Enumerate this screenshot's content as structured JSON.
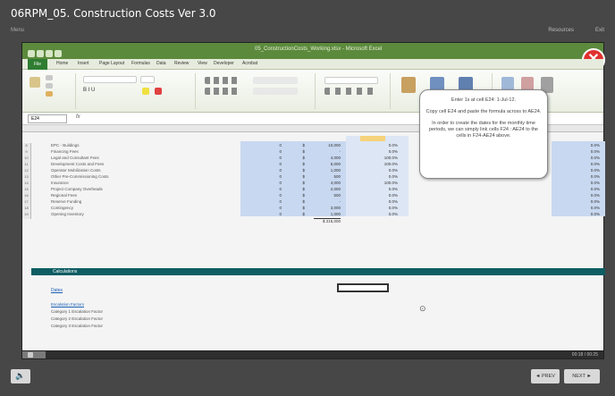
{
  "player": {
    "course_title": "06RPM_05. Construction Costs Ver 3.0",
    "menu": "Menu",
    "resources": "Resources",
    "exit": "Exit",
    "time": "00:18 / 00:25",
    "prev": "◄ PREV",
    "next": "NEXT ►",
    "volume_icon": "speaker-icon",
    "progress": 0.04
  },
  "excel": {
    "window_title": "05_ConstructionCosts_Working.xlsx - Microsoft Excel",
    "tabs": [
      "File",
      "Home",
      "Insert",
      "Page Layout",
      "Formulas",
      "Data",
      "Review",
      "View",
      "Developer",
      "Acrobat"
    ],
    "name_box": "E24",
    "rows": [
      {
        "label": "EPC - Buildings",
        "v1": "0",
        "v2": "$",
        "v3": "10,000",
        "v4": "0.0%",
        "pct": "0.0%"
      },
      {
        "label": "Financing Fees",
        "v1": "0",
        "v2": "$",
        "v3": "-",
        "v4": "0.0%",
        "pct": "0.0%"
      },
      {
        "label": "Legal and Consultant Fees",
        "v1": "0",
        "v2": "$",
        "v3": "4,000",
        "v4": "100.0%",
        "pct": "0.0%"
      },
      {
        "label": "Development Costs and Fees",
        "v1": "0",
        "v2": "$",
        "v3": "6,000",
        "v4": "100.0%",
        "pct": "0.0%"
      },
      {
        "label": "Operator Mobilization Costs",
        "v1": "0",
        "v2": "$",
        "v3": "1,000",
        "v4": "0.0%",
        "pct": "0.0%"
      },
      {
        "label": "Other Pre-Commissioning Costs",
        "v1": "0",
        "v2": "$",
        "v3": "500",
        "v4": "0.0%",
        "pct": "0.0%"
      },
      {
        "label": "Insurance",
        "v1": "0",
        "v2": "$",
        "v3": "4,000",
        "v4": "100.0%",
        "pct": "0.0%"
      },
      {
        "label": "Project Company Overheads",
        "v1": "0",
        "v2": "$",
        "v3": "2,000",
        "v4": "0.0%",
        "pct": "0.0%"
      },
      {
        "label": "Regional Fees",
        "v1": "0",
        "v2": "$",
        "v3": "500",
        "v4": "0.0%",
        "pct": "0.0%"
      },
      {
        "label": "Reserve Funding",
        "v1": "0",
        "v2": "$",
        "v3": "-",
        "v4": "0.0%",
        "pct": "0.0%"
      },
      {
        "label": "Contingency",
        "v1": "0",
        "v2": "$",
        "v3": "3,000",
        "v4": "0.0%",
        "pct": "0.0%"
      },
      {
        "label": "Opening Inventory",
        "v1": "0",
        "v2": "$",
        "v3": "1,000",
        "v4": "0.0%",
        "pct": "0.0%"
      }
    ],
    "total": "215,000",
    "section_title": "Calculations",
    "dates_label": "Dates",
    "escalation_label": "Escalation Factors",
    "cat_rows": [
      "Category 1 Escalation Factor",
      "Category 2 Escalation Factor",
      "Category 3 Escalation Factor"
    ],
    "callout": [
      "Enter 1s at cell E24: 1-Jul-12.",
      "Copy cell E24 and paste the formula across to AE24.",
      "In order to create the dates for the monthly time periods, we can simply link cells F24 : AE24 to the cells in F24-AE24 above."
    ]
  },
  "colors": {
    "accent": "#0e5d63",
    "excel_green": "#5c8a3c",
    "close": "#e03030"
  }
}
